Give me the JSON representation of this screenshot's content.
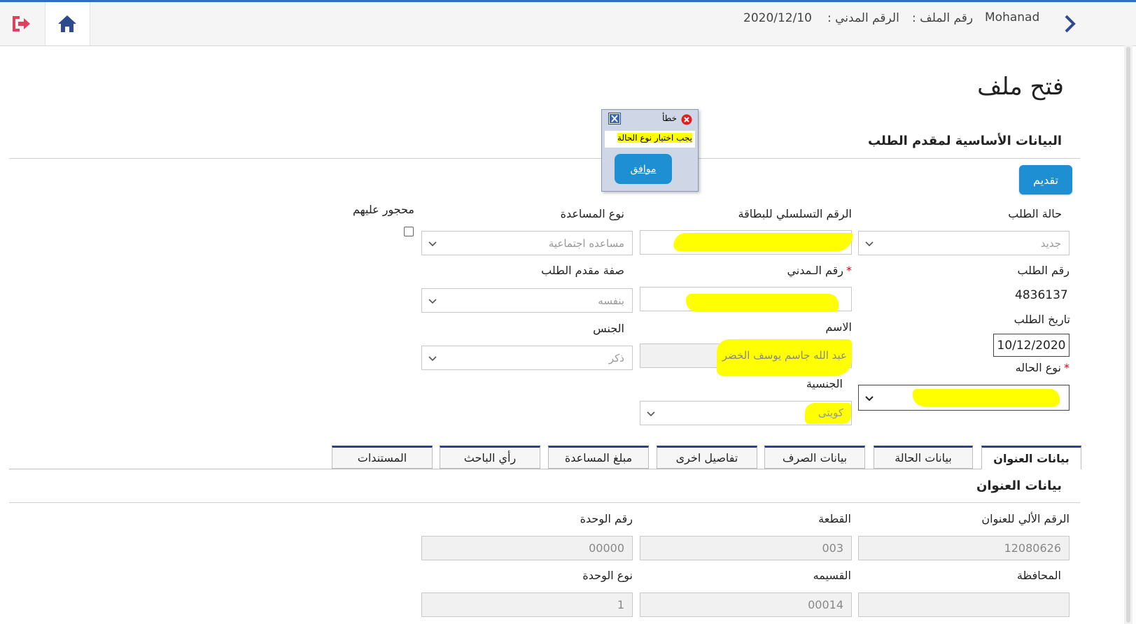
{
  "header": {
    "user_name": "Mohanad",
    "file_number_label": "رقم الملف :",
    "civil_id_label": "الرقم المدني :",
    "date": "2020/12/10"
  },
  "page": {
    "title": "فتح ملف",
    "section_basic": "البيانات الأساسية لمقدم الطلب",
    "submit_label": "تقديم"
  },
  "dialog": {
    "title": "خطأ",
    "message": "يجب اختيار نوع الحالة",
    "ok_label": "موافق"
  },
  "form": {
    "request_status": {
      "label": "حالة الطلب",
      "value": "جديد"
    },
    "card_serial": {
      "label": "الرقم التسلسلي للبطاقة",
      "value": ""
    },
    "aid_type": {
      "label": "نوع المساعدة",
      "value": "مساعده اجتماعية"
    },
    "interdicted": {
      "label": "محجور عليهم"
    },
    "request_number": {
      "label": "رقم الطلب",
      "value": "4836137"
    },
    "civil_id": {
      "label": "رقم الـمدني",
      "required": "*",
      "value": ""
    },
    "applicant_capacity": {
      "label": "صفة مقدم الطلب",
      "value": "بنفسه"
    },
    "request_date": {
      "label": "تاريخ الطلب",
      "value": "10/12/2020"
    },
    "name": {
      "label": "الاسم",
      "value": "عبد الله جاسم يوسف الخضر"
    },
    "gender": {
      "label": "الجنس",
      "value": "ذكر"
    },
    "case_type": {
      "label": "نوع الحاله",
      "required": "*",
      "value": ""
    },
    "nationality": {
      "label": "الجنسية",
      "value": "كويتى"
    }
  },
  "tabs": [
    {
      "label": "بيانات العنوان"
    },
    {
      "label": "بيانات الحالة"
    },
    {
      "label": "بيانات الصرف"
    },
    {
      "label": "تفاصيل اخرى"
    },
    {
      "label": "مبلغ المساعدة"
    },
    {
      "label": "رأي الباحث"
    },
    {
      "label": "المستندات"
    }
  ],
  "address": {
    "section_title": "بيانات العنوان",
    "auto_number": {
      "label": "الرقم الألي للعنوان",
      "value": "12080626"
    },
    "block": {
      "label": "القطعة",
      "value": "003"
    },
    "unit_number": {
      "label": "رقم الوحدة",
      "value": "00000"
    },
    "governorate": {
      "label": "المحافظة",
      "value": ""
    },
    "plot": {
      "label": "القسيمه",
      "value": "00014"
    },
    "unit_type": {
      "label": "نوع الوحدة",
      "value": "1"
    }
  },
  "colors": {
    "primary_button": "#1f8fd4",
    "tab_border": "#2d3f8f",
    "highlight": "#ffff00",
    "required": "#d0021b"
  }
}
